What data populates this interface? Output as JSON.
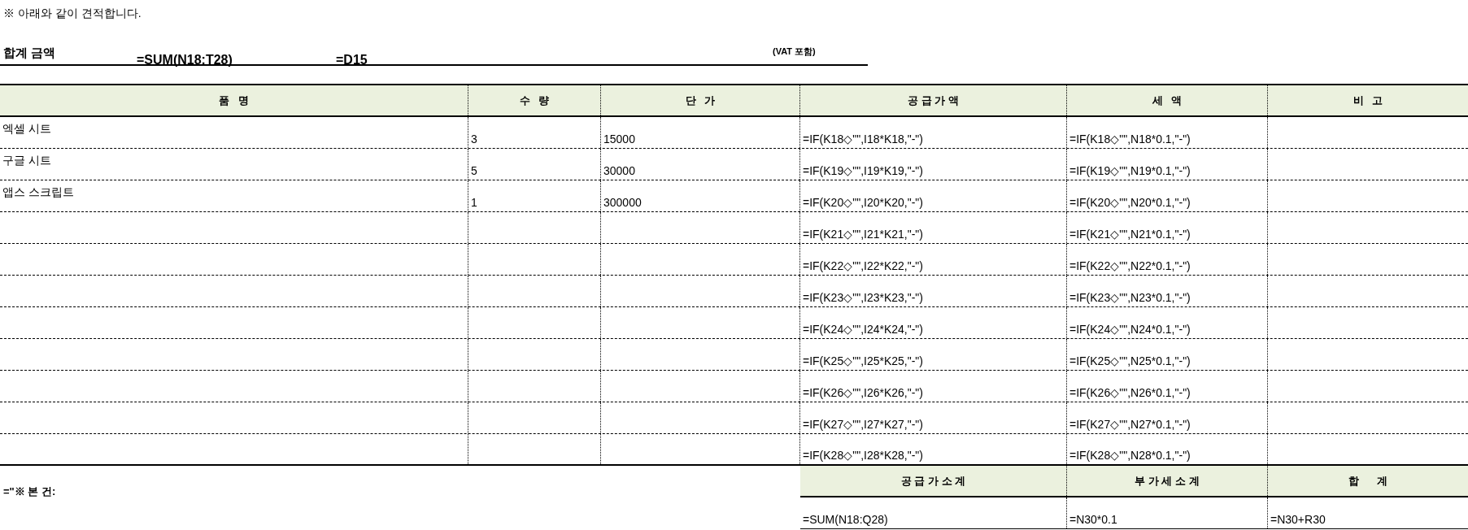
{
  "note": "※ 아래와 같이 견적합니다.",
  "total": {
    "label": "합계 금액",
    "formula": "=SUM(N18:T28)",
    "reference": "=D15",
    "vat_note": "(VAT 포함)"
  },
  "table": {
    "columns": [
      "품   명",
      "수   량",
      "단   가",
      "공 급 가 액",
      "세   액",
      "비   고"
    ],
    "rows": [
      {
        "item": "엑셀 시트",
        "quantity": "3",
        "unit_price": "15000",
        "supply_amount": "=IF(K18◇\"\",I18*K18,\"-\")",
        "tax": "=IF(K18◇\"\",N18*0.1,\"-\")"
      },
      {
        "item": "구글 시트",
        "quantity": "5",
        "unit_price": "30000",
        "supply_amount": "=IF(K19◇\"\",I19*K19,\"-\")",
        "tax": "=IF(K19◇\"\",N19*0.1,\"-\")"
      },
      {
        "item": "앱스 스크립트",
        "quantity": "1",
        "unit_price": "300000",
        "supply_amount": "=IF(K20◇\"\",I20*K20,\"-\")",
        "tax": "=IF(K20◇\"\",N20*0.1,\"-\")"
      },
      {
        "supply_amount": "=IF(K21◇\"\",I21*K21,\"-\")",
        "tax": "=IF(K21◇\"\",N21*0.1,\"-\")"
      },
      {
        "supply_amount": "=IF(K22◇\"\",I22*K22,\"-\")",
        "tax": "=IF(K22◇\"\",N22*0.1,\"-\")"
      },
      {
        "supply_amount": "=IF(K23◇\"\",I23*K23,\"-\")",
        "tax": "=IF(K23◇\"\",N23*0.1,\"-\")"
      },
      {
        "supply_amount": "=IF(K24◇\"\",I24*K24,\"-\")",
        "tax": "=IF(K24◇\"\",N24*0.1,\"-\")"
      },
      {
        "supply_amount": "=IF(K25◇\"\",I25*K25,\"-\")",
        "tax": "=IF(K25◇\"\",N25*0.1,\"-\")"
      },
      {
        "supply_amount": "=IF(K26◇\"\",I26*K26,\"-\")",
        "tax": "=IF(K26◇\"\",N26*0.1,\"-\")"
      },
      {
        "supply_amount": "=IF(K27◇\"\",I27*K27,\"-\")",
        "tax": "=IF(K27◇\"\",N27*0.1,\"-\")"
      },
      {
        "supply_amount": "=IF(K28◇\"\",I28*K28,\"-\")",
        "tax": "=IF(K28◇\"\",N28*0.1,\"-\")"
      }
    ]
  },
  "summary": {
    "note": "=\"※ 본 건:",
    "columns": [
      "공 급 가 소 계",
      "부 가 세 소 계",
      "합      계"
    ],
    "values": [
      "=SUM(N18:Q28)",
      "=N30*0.1",
      "=N30+R30"
    ]
  }
}
